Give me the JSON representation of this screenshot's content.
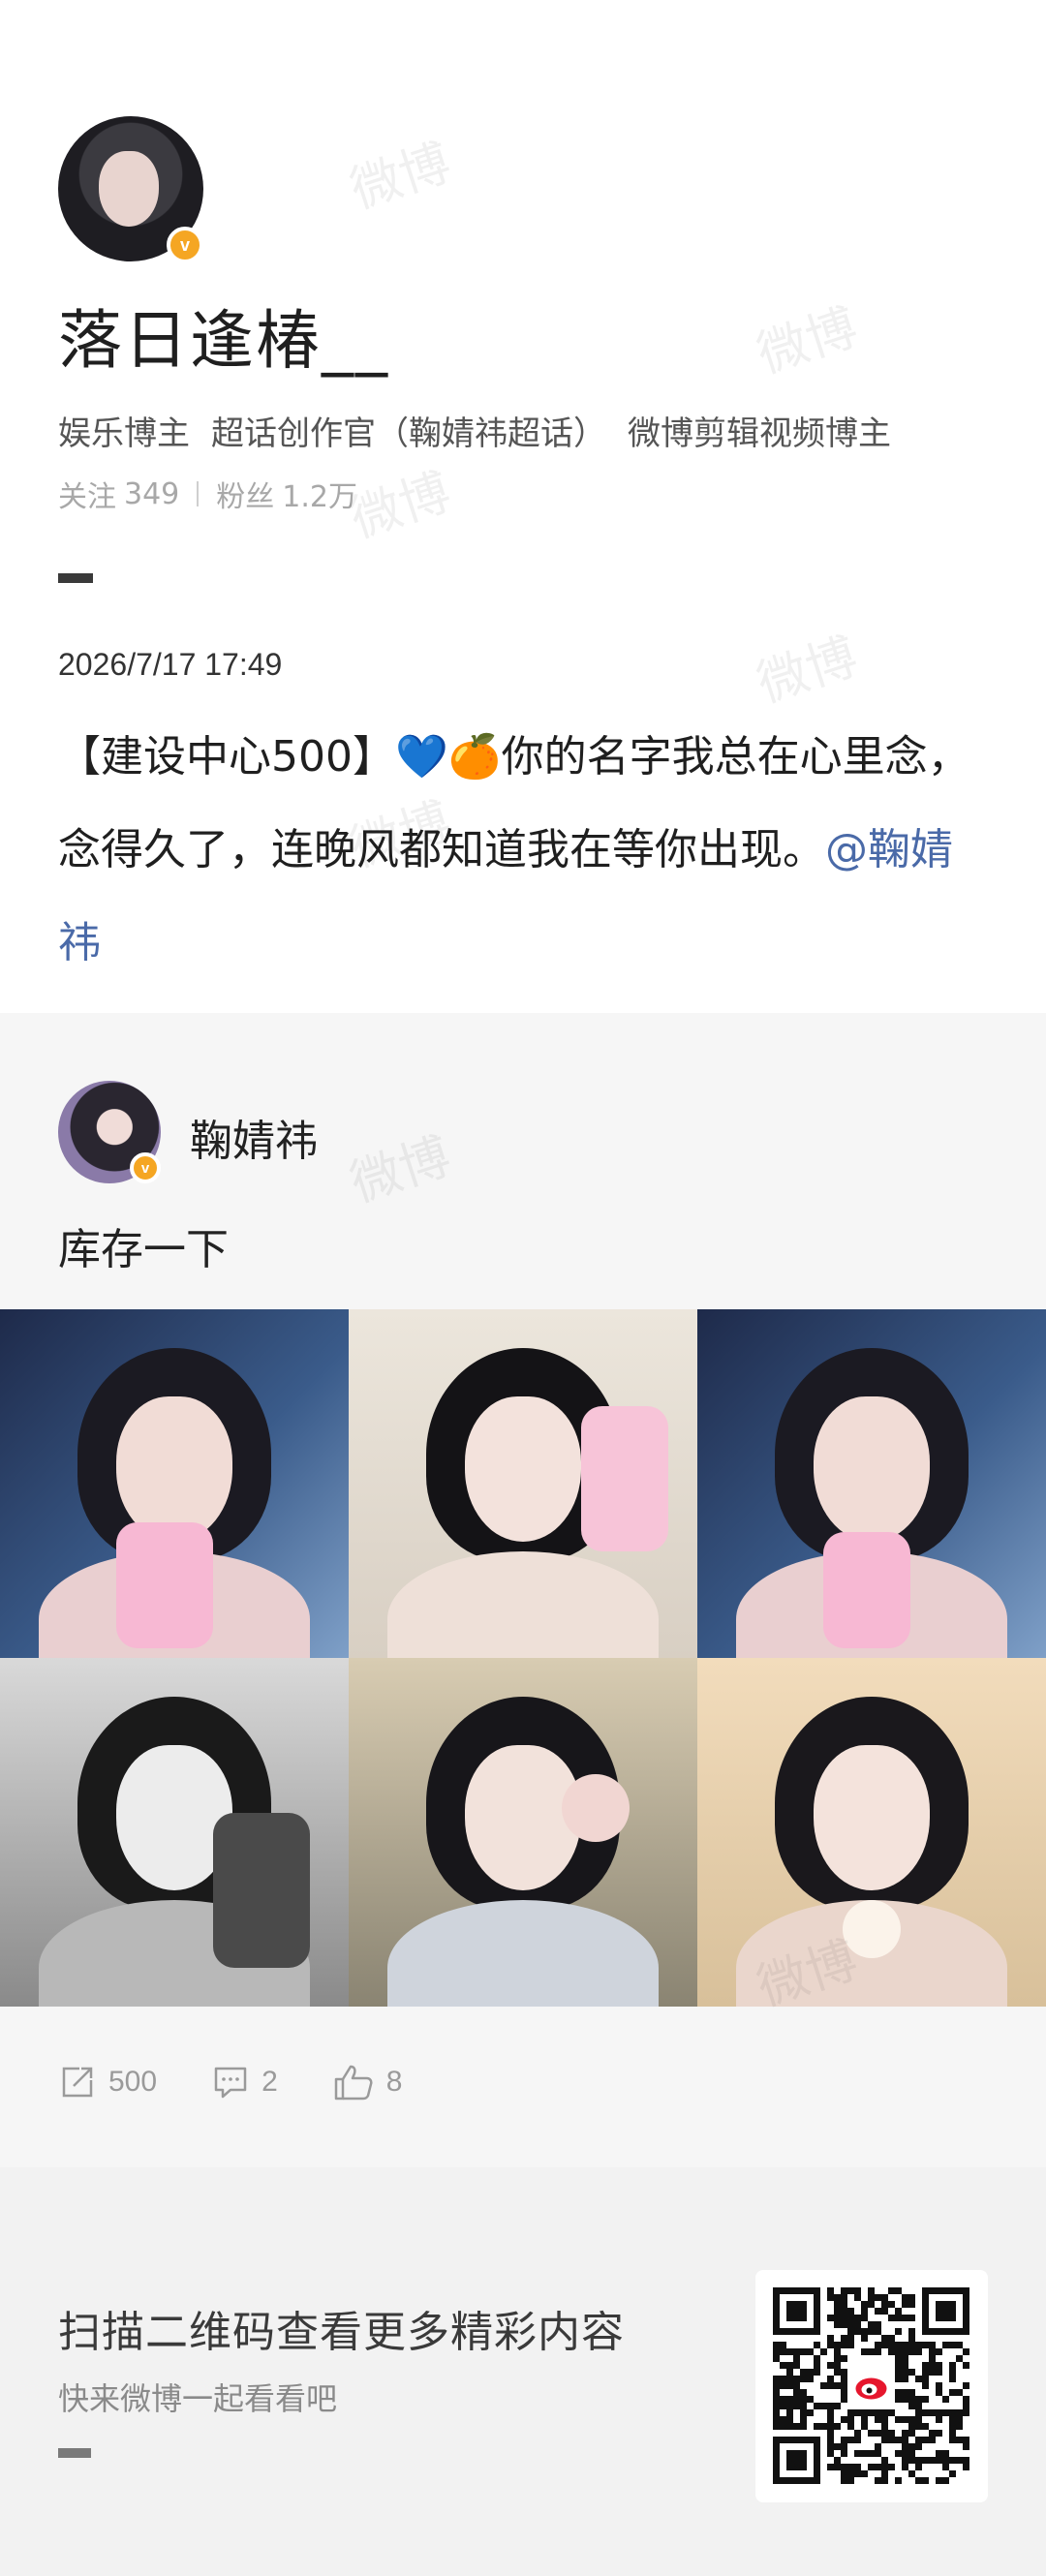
{
  "profile": {
    "username": "落日逢椿__",
    "verified_badge": "v",
    "tags": [
      "娱乐博主",
      "超话创作官（鞠婧祎超话）",
      "微博剪辑视频博主"
    ],
    "following_label": "关注",
    "following_count": "349",
    "followers_label": "粉丝",
    "followers_count": "1.2万"
  },
  "post": {
    "time": "2026/7/17  17:49",
    "text_prefix": "【建设中心500】",
    "emoji_heart": "💙",
    "emoji_orange": "🍊",
    "text_body": "你的名字我总在心里念，念得久了，连晚风都知道我在等你出现。",
    "mention": "@鞠婧祎"
  },
  "quoted": {
    "author": "鞠婧祎",
    "verified_badge": "v",
    "text": "库存一下",
    "photos": [
      "photo-1",
      "photo-2",
      "photo-3",
      "photo-4",
      "photo-5",
      "photo-6"
    ],
    "reposts": "500",
    "comments": "2",
    "likes": "8"
  },
  "footer": {
    "title": "扫描二维码查看更多精彩内容",
    "subtitle": "快来微博一起看看吧"
  },
  "watermark": "微博",
  "icons": {
    "repost": "repost-icon",
    "comment": "comment-icon",
    "like": "thumbs-up-icon",
    "qr": "qr-code-icon"
  },
  "colors": {
    "mention": "#4a6aa8",
    "badge": "#f5a623",
    "quote_bg": "#f6f6f6",
    "footer_bg": "#f2f2f2"
  }
}
